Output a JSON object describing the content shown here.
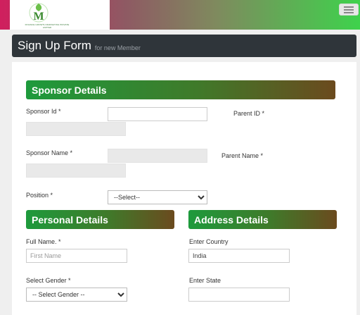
{
  "brand": {
    "logo_letter": "M",
    "logo_tagline": "FINANCE GROWTH MARKETING PRIVATE LIMITED",
    "topbar_colors": [
      "#d01f5e",
      "#3ed24c"
    ]
  },
  "header": {
    "title": "Sign Up Form",
    "subtitle": "for new Member"
  },
  "sponsor": {
    "heading": "Sponsor Details",
    "sponsor_id_label": "Sponsor Id *",
    "sponsor_id_value": "",
    "parent_id_label": "Parent ID *",
    "sponsor_name_label": "Sponsor Name *",
    "parent_name_label": "Parent Name *",
    "position_label": "Position *",
    "position_selected": "--Select--"
  },
  "personal": {
    "heading": "Personal Details",
    "full_name_label": "Full Name. *",
    "full_name_placeholder": "First Name",
    "gender_label": "Select Gender *",
    "gender_selected": "-- Select Gender --"
  },
  "address": {
    "heading": "Address Details",
    "country_label": "Enter Country",
    "country_value": "India",
    "state_label": "Enter State",
    "state_value": ""
  }
}
